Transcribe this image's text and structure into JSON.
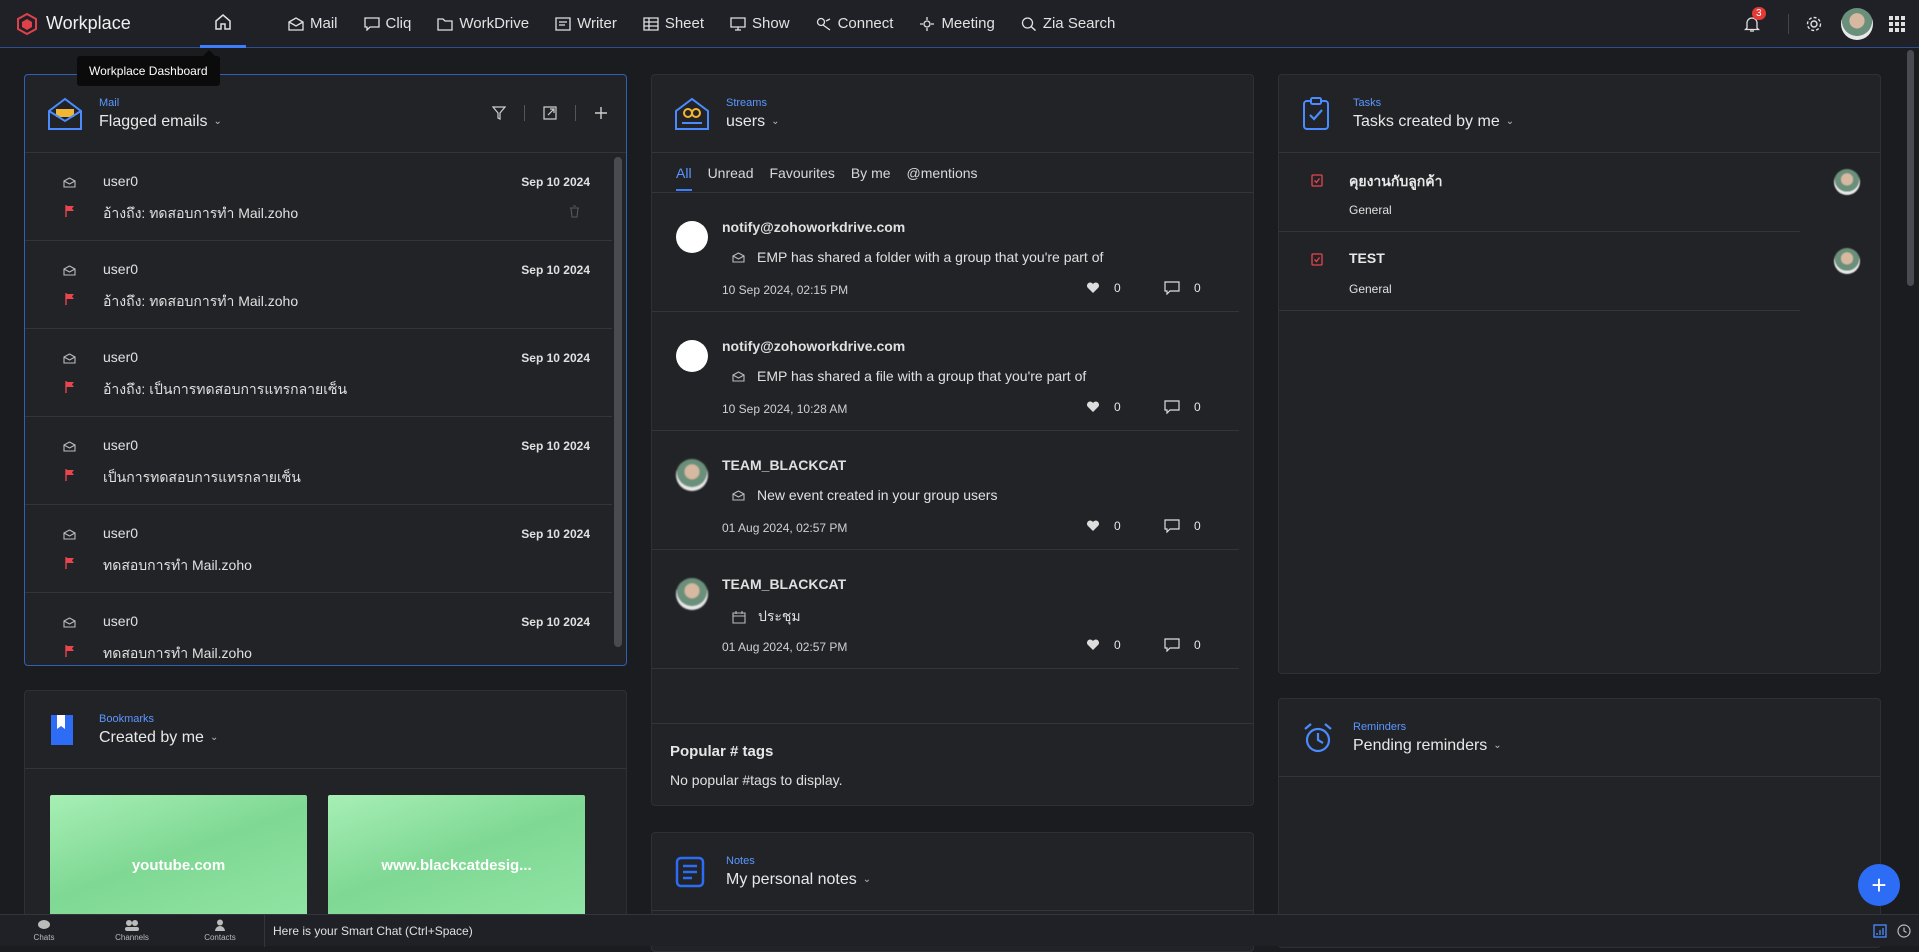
{
  "brand": {
    "name": "Workplace"
  },
  "tooltip": "Workplace Dashboard",
  "apps": [
    {
      "label": "Mail",
      "icon": "mail-icon"
    },
    {
      "label": "Cliq",
      "icon": "chat-icon"
    },
    {
      "label": "WorkDrive",
      "icon": "drive-icon"
    },
    {
      "label": "Writer",
      "icon": "writer-icon"
    },
    {
      "label": "Sheet",
      "icon": "sheet-icon"
    },
    {
      "label": "Show",
      "icon": "show-icon"
    },
    {
      "label": "Connect",
      "icon": "connect-icon"
    },
    {
      "label": "Meeting",
      "icon": "meeting-icon"
    },
    {
      "label": "Zia Search",
      "icon": "search-icon"
    }
  ],
  "notifications": {
    "count": "3"
  },
  "mail": {
    "kicker": "Mail",
    "title": "Flagged emails",
    "rows": [
      {
        "from": "user0",
        "subject": "อ้างถึง: ทดสอบการทำ Mail.zoho",
        "date": "Sep 10 2024"
      },
      {
        "from": "user0",
        "subject": "อ้างถึง: ทดสอบการทำ Mail.zoho",
        "date": "Sep 10 2024"
      },
      {
        "from": "user0",
        "subject": "อ้างถึง: เป็นการทดสอบการแทรกลายเซ็น",
        "date": "Sep 10 2024"
      },
      {
        "from": "user0",
        "subject": "เป็นการทดสอบการแทรกลายเซ็น",
        "date": "Sep 10 2024"
      },
      {
        "from": "user0",
        "subject": "ทดสอบการทำ Mail.zoho",
        "date": "Sep 10 2024"
      },
      {
        "from": "user0",
        "subject": "ทดสอบการทำ Mail.zoho",
        "date": "Sep 10 2024"
      }
    ]
  },
  "streams": {
    "kicker": "Streams",
    "title": "users",
    "tabs": [
      "All",
      "Unread",
      "Favourites",
      "By me",
      "@mentions"
    ],
    "items": [
      {
        "who": "notify@zohoworkdrive.com",
        "message": "EMP has shared a folder with a group that you're part of",
        "when": "10 Sep 2024, 02:15 PM",
        "likes": "0",
        "comments": "0"
      },
      {
        "who": "notify@zohoworkdrive.com",
        "message": "EMP has shared a file with a group that you're part of",
        "when": "10 Sep 2024, 10:28 AM",
        "likes": "0",
        "comments": "0"
      },
      {
        "who": "TEAM_BLACKCAT",
        "message": "New event created in your group users",
        "when": "01 Aug 2024, 02:57 PM",
        "likes": "0",
        "comments": "0"
      },
      {
        "who": "TEAM_BLACKCAT",
        "message": "ประชุม",
        "when": "01 Aug 2024, 02:57 PM",
        "likes": "0",
        "comments": "0"
      }
    ],
    "popular_title": "Popular # tags",
    "popular_empty": "No popular #tags to display."
  },
  "tasks": {
    "kicker": "Tasks",
    "title": "Tasks created by me",
    "rows": [
      {
        "name": "คุยงานกับลูกค้า",
        "category": "General"
      },
      {
        "name": "TEST",
        "category": "General"
      }
    ]
  },
  "bookmarks": {
    "kicker": "Bookmarks",
    "title": "Created by me",
    "tiles": [
      "youtube.com",
      "www.blackcatdesig..."
    ]
  },
  "notes": {
    "kicker": "Notes",
    "title": "My personal notes"
  },
  "reminders": {
    "kicker": "Reminders",
    "title": "Pending reminders"
  },
  "bottombar": {
    "items": [
      "Chats",
      "Channels",
      "Contacts"
    ],
    "smartchat": "Here is your Smart Chat (Ctrl+Space)"
  },
  "colors": {
    "accent": "#3d7eff",
    "flag": "#e8454f",
    "bookmark_tile": "#8fe3a2"
  }
}
